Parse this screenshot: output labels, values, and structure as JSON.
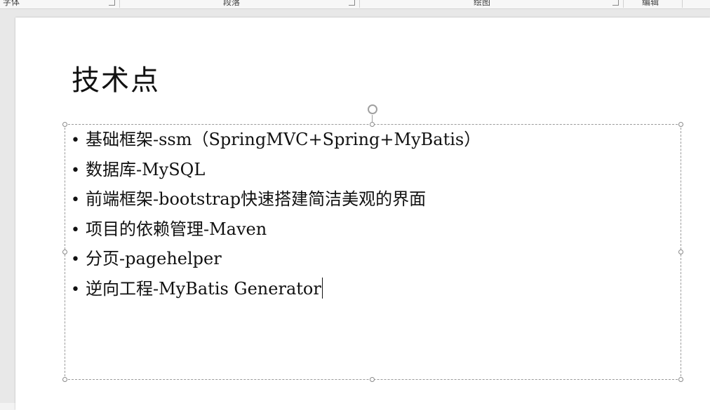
{
  "ribbon": {
    "groups": [
      {
        "label": "字体"
      },
      {
        "label": "段落"
      },
      {
        "label": "绘图"
      },
      {
        "label": "编辑"
      }
    ]
  },
  "slide": {
    "title": "技术点",
    "bullets": [
      {
        "text": "基础框架-ssm（SpringMVC+Spring+MyBatis）"
      },
      {
        "text": "数据库-MySQL"
      },
      {
        "text": "前端框架-bootstrap快速搭建简洁美观的界面"
      },
      {
        "text": "项目的依赖管理-Maven"
      },
      {
        "text": "分页-pagehelper"
      },
      {
        "text": "逆向工程-MyBatis Generator"
      }
    ]
  }
}
